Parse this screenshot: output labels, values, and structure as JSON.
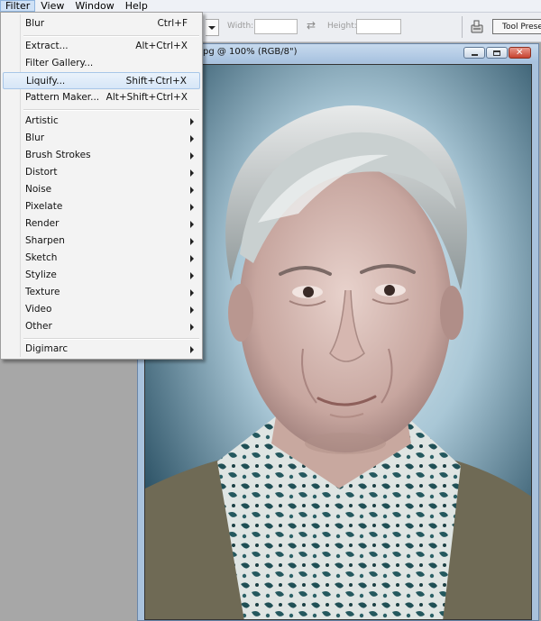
{
  "menubar": {
    "items": [
      "Filter",
      "View",
      "Window",
      "Help"
    ]
  },
  "options_bar": {
    "width_label": "Width:",
    "height_label": "Height:",
    "tool_presets_label": "Tool Presets"
  },
  "document": {
    "title": "pg @ 100% (RGB/8\")",
    "close_glyph": "✕"
  },
  "filter_menu": {
    "recent": {
      "label": "Blur",
      "shortcut": "Ctrl+F"
    },
    "top_items": [
      {
        "label": "Extract...",
        "shortcut": "Alt+Ctrl+X"
      },
      {
        "label": "Filter Gallery...",
        "shortcut": ""
      },
      {
        "label": "Liquify...",
        "shortcut": "Shift+Ctrl+X",
        "highlighted": true
      },
      {
        "label": "Pattern Maker...",
        "shortcut": "Alt+Shift+Ctrl+X"
      }
    ],
    "submenus": [
      "Artistic",
      "Blur",
      "Brush Strokes",
      "Distort",
      "Noise",
      "Pixelate",
      "Render",
      "Sharpen",
      "Sketch",
      "Stylize",
      "Texture",
      "Video",
      "Other"
    ],
    "bottom_items": [
      "Digimarc"
    ]
  },
  "colors": {
    "menu_highlight": "#d6e6f7",
    "workspace": "#a7a7a7",
    "photo_background": "#2f5b73"
  }
}
